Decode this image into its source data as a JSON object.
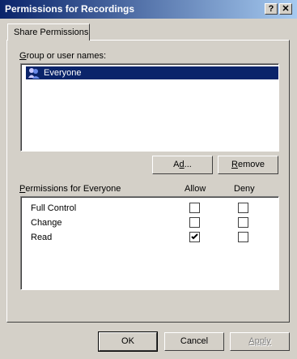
{
  "window": {
    "title": "Permissions for Recordings",
    "help_label": "?",
    "close_label": "✕"
  },
  "tab": {
    "label": "Share Permissions"
  },
  "groups": {
    "label_hotkey": "G",
    "label_rest": "roup or user names:",
    "items": [
      {
        "name": "Everyone",
        "icon": "group-icon",
        "selected": true
      }
    ]
  },
  "buttons": {
    "add_pre": "A",
    "add_hot": "d",
    "add_post": "d...",
    "remove_hot": "R",
    "remove_post": "emove",
    "ok": "OK",
    "cancel": "Cancel",
    "apply": "Apply"
  },
  "permissions": {
    "label_hot": "P",
    "label_rest": "ermissions for Everyone",
    "allow_header": "Allow",
    "deny_header": "Deny",
    "rows": [
      {
        "name": "Full Control",
        "allow": false,
        "deny": false
      },
      {
        "name": "Change",
        "allow": false,
        "deny": false
      },
      {
        "name": "Read",
        "allow": true,
        "deny": false
      }
    ]
  },
  "colors": {
    "selection": "#0a246a",
    "face": "#d4d0c8",
    "title_start": "#0a246a",
    "title_end": "#a6caf0"
  }
}
